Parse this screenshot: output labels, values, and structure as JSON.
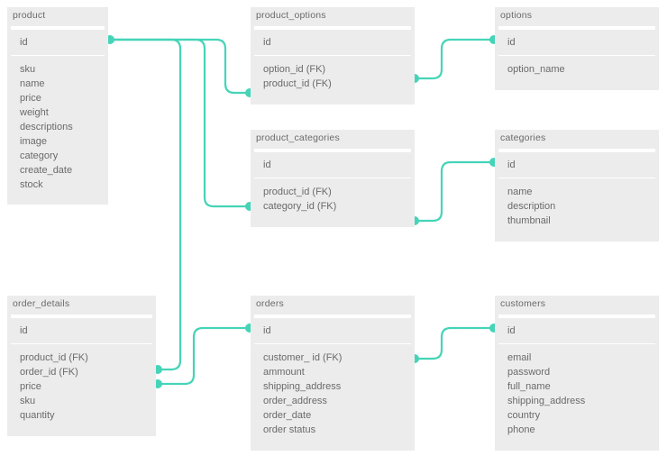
{
  "entities": {
    "product": {
      "title": "product",
      "pk": "id",
      "fields": [
        "sku",
        "name",
        "price",
        "weight",
        "descriptions",
        "image",
        "category",
        "create_date",
        "stock"
      ]
    },
    "product_options": {
      "title": "product_options",
      "pk": "id",
      "fields": [
        "option_id (FK)",
        "product_id (FK)"
      ]
    },
    "options": {
      "title": "options",
      "pk": "id",
      "fields": [
        "option_name"
      ]
    },
    "product_categories": {
      "title": "product_categories",
      "pk": "id",
      "fields": [
        "product_id (FK)",
        "category_id  (FK)"
      ]
    },
    "categories": {
      "title": "categories",
      "pk": "id",
      "fields": [
        "name",
        "description",
        "thumbnail"
      ]
    },
    "order_details": {
      "title": "order_details",
      "pk": "id",
      "fields": [
        "product_id  (FK)",
        "order_id (FK)",
        "price",
        "sku",
        "quantity"
      ]
    },
    "orders": {
      "title": "orders",
      "pk": "id",
      "fields": [
        "customer_ id  (FK)",
        "ammount",
        "shipping_address",
        "order_address",
        "order_date",
        "order status"
      ]
    },
    "customers": {
      "title": "customers",
      "pk": "id",
      "fields": [
        "email",
        "password",
        "full_name",
        "shipping_address",
        "country",
        "phone"
      ]
    }
  }
}
